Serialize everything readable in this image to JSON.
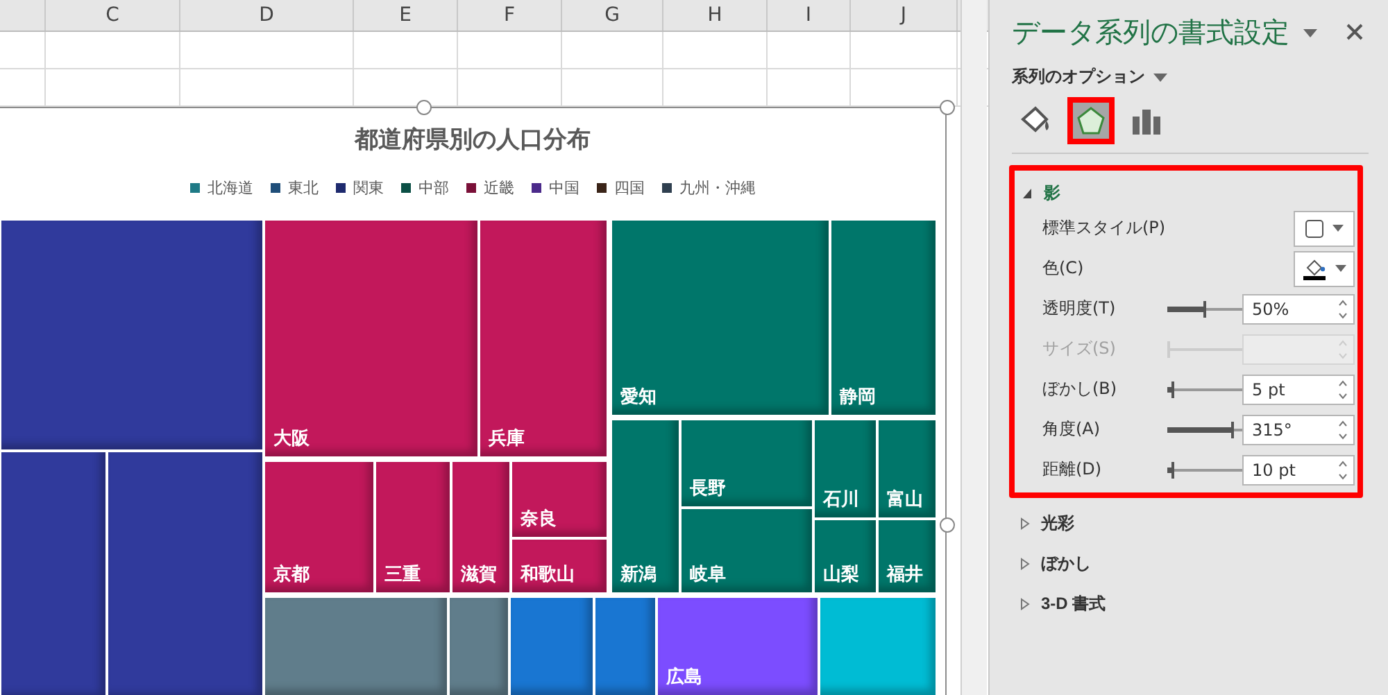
{
  "sheet": {
    "columns": [
      "C",
      "D",
      "E",
      "F",
      "G",
      "H",
      "I",
      "J"
    ]
  },
  "chart": {
    "title": "都道府県別の人口分布",
    "legend": [
      {
        "label": "北海道",
        "color": "#1f7a86"
      },
      {
        "label": "東北",
        "color": "#1f4e79"
      },
      {
        "label": "関東",
        "color": "#1e2a6e"
      },
      {
        "label": "中部",
        "color": "#0b4f45"
      },
      {
        "label": "近畿",
        "color": "#7a1038"
      },
      {
        "label": "中国",
        "color": "#4b2a8a"
      },
      {
        "label": "四国",
        "color": "#3a2418"
      },
      {
        "label": "九州・沖縄",
        "color": "#2f3f4f"
      }
    ],
    "tiles": [
      {
        "color": "#303a9c"
      },
      {
        "color": "#303a9c"
      },
      {
        "color": "#303a9c"
      },
      {
        "label": "大阪",
        "color": "#c2185b"
      },
      {
        "label": "兵庫",
        "color": "#c2185b"
      },
      {
        "label": "京都",
        "color": "#c2185b"
      },
      {
        "label": "三重",
        "color": "#c2185b"
      },
      {
        "label": "滋賀",
        "color": "#c2185b"
      },
      {
        "label": "奈良",
        "color": "#c2185b"
      },
      {
        "label": "和歌山",
        "color": "#c2185b"
      },
      {
        "label": "愛知",
        "color": "#00766a"
      },
      {
        "label": "静岡",
        "color": "#00766a"
      },
      {
        "label": "新潟",
        "color": "#00766a"
      },
      {
        "label": "長野",
        "color": "#00766a"
      },
      {
        "label": "岐阜",
        "color": "#00766a"
      },
      {
        "label": "石川",
        "color": "#00766a"
      },
      {
        "label": "富山",
        "color": "#00766a"
      },
      {
        "label": "山梨",
        "color": "#00766a"
      },
      {
        "label": "福井",
        "color": "#00766a"
      },
      {
        "color": "#607d8b"
      },
      {
        "color": "#607d8b"
      },
      {
        "color": "#1976d2"
      },
      {
        "color": "#1976d2"
      },
      {
        "label": "広島",
        "color": "#7c4dff"
      },
      {
        "color": "#00bcd4"
      }
    ]
  },
  "panel": {
    "title": "データ系列の書式設定",
    "options_label": "系列のオプション",
    "tabs": [
      {
        "kind": "fill",
        "selected": false
      },
      {
        "kind": "effects",
        "selected": true
      },
      {
        "kind": "series",
        "selected": false
      }
    ],
    "sections": [
      {
        "label": "影",
        "expanded": true,
        "highlighted": true,
        "rows": [
          {
            "kind": "style",
            "label": "標準スタイル(P)",
            "disabled": false
          },
          {
            "kind": "color",
            "label": "色(C)",
            "disabled": false
          },
          {
            "kind": "slider",
            "label": "透明度(T)",
            "level": 0.5,
            "value": "50%",
            "disabled": false
          },
          {
            "kind": "slider",
            "label": "サイズ(S)",
            "level": 0,
            "disabled": true
          },
          {
            "kind": "slider",
            "label": "ぼかし(B)",
            "level": 0.05,
            "value": "5 pt",
            "disabled": false
          },
          {
            "kind": "slider",
            "label": "角度(A)",
            "level": 0.88,
            "value": "315°",
            "disabled": false
          },
          {
            "kind": "slider",
            "label": "距離(D)",
            "level": 0.05,
            "value": "10 pt",
            "disabled": false
          }
        ]
      },
      {
        "label": "光彩",
        "expanded": false,
        "highlighted": false
      },
      {
        "label": "ぼかし",
        "expanded": false,
        "highlighted": false
      },
      {
        "label": "3-D 書式",
        "expanded": false,
        "highlighted": false
      }
    ]
  }
}
